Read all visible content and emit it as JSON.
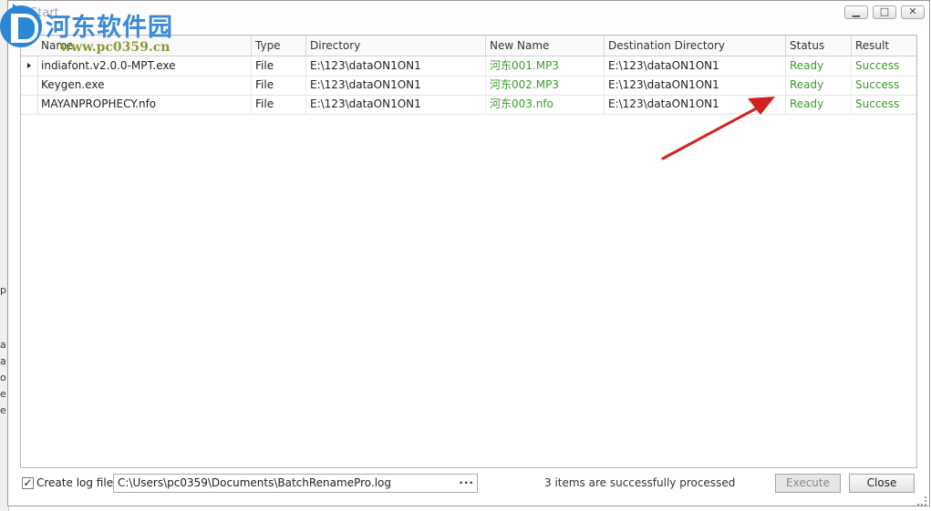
{
  "window": {
    "title": "Start",
    "minimize_label": "▁",
    "maximize_label": "□",
    "close_label": "✕"
  },
  "watermark": {
    "text": "河东软件园",
    "url": "www.pc0359.cn"
  },
  "grid": {
    "columns": [
      "Name",
      "Type",
      "Directory",
      "New Name",
      "Destination Directory",
      "Status",
      "Result"
    ],
    "rows": [
      {
        "name": "indiafont.v2.0.0-MPT.exe",
        "type": "File",
        "directory": "E:\\123\\dataON1ON1",
        "new_name": "河东001.MP3",
        "destination": "E:\\123\\dataON1ON1",
        "status": "Ready",
        "result": "Success"
      },
      {
        "name": "Keygen.exe",
        "type": "File",
        "directory": "E:\\123\\dataON1ON1",
        "new_name": "河东002.MP3",
        "destination": "E:\\123\\dataON1ON1",
        "status": "Ready",
        "result": "Success"
      },
      {
        "name": "MAYANPROPHECY.nfo",
        "type": "File",
        "directory": "E:\\123\\dataON1ON1",
        "new_name": "河东003.nfo",
        "destination": "E:\\123\\dataON1ON1",
        "status": "Ready",
        "result": "Success"
      }
    ]
  },
  "footer": {
    "create_log_label": "Create log file:",
    "create_log_checked": true,
    "check_mark": "✓",
    "log_path": "C:\\Users\\pc0359\\Documents\\BatchRenamePro.log",
    "browse_label": "···",
    "status_text": "3 items are successfully processed",
    "execute_label": "Execute",
    "close_label": "Close"
  },
  "left_panel": {
    "fragments": [
      "p",
      "a",
      "a",
      "o",
      "e",
      "e"
    ]
  },
  "colors": {
    "success_green": "#3d9a2e",
    "annotation_red": "#d42020",
    "accent_blue": "#2f7fd0"
  }
}
